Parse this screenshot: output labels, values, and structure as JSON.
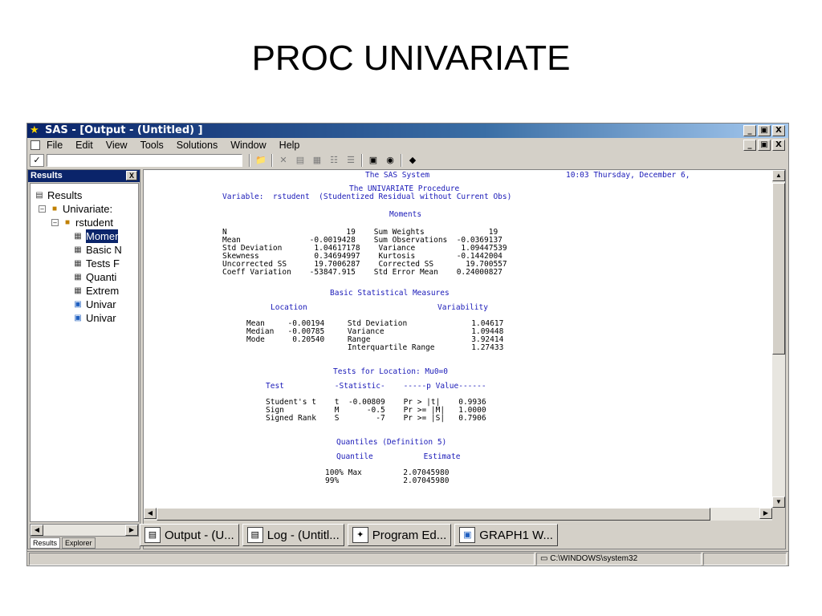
{
  "slide": {
    "title": "PROC UNIVARIATE"
  },
  "window": {
    "title": "SAS - [Output - (Untitled) ]",
    "controls": {
      "minimize": "_",
      "restore": "▣",
      "close": "X"
    }
  },
  "menu": {
    "items": [
      "File",
      "Edit",
      "View",
      "Tools",
      "Solutions",
      "Window",
      "Help"
    ]
  },
  "toolbar": {
    "command_check": "✓",
    "command_value": ""
  },
  "results": {
    "title": "Results",
    "tree": [
      {
        "label": "Results",
        "icon": "results-icon"
      },
      {
        "label": "Univariate:",
        "icon": "folder-icon"
      },
      {
        "label": "rstudent",
        "icon": "folder-icon"
      },
      {
        "label": "Momer",
        "icon": "table-icon"
      },
      {
        "label": "Basic N",
        "icon": "table-icon"
      },
      {
        "label": "Tests F",
        "icon": "table-icon"
      },
      {
        "label": "Quanti",
        "icon": "table-icon"
      },
      {
        "label": "Extrem",
        "icon": "table-icon"
      },
      {
        "label": "Univar",
        "icon": "graph-icon"
      },
      {
        "label": "Univar",
        "icon": "graph-icon"
      }
    ],
    "tabs": [
      "Results",
      "Explorer"
    ]
  },
  "output": {
    "header_title": "The SAS System",
    "header_time": "10:03 Thursday, December 6,",
    "procedure": "The UNIVARIATE Procedure",
    "variable": "Variable:  rstudent  (Studentized Residual without Current Obs)",
    "moments_title": "Moments",
    "moments": [
      "N                          19    Sum Weights              19",
      "Mean               -0.0019428    Sum Observations  -0.0369137",
      "Std Deviation       1.04617178    Variance          1.09447539",
      "Skewness            0.34694997    Kurtosis         -0.1442004",
      "Uncorrected SS      19.7006287    Corrected SS       19.700557",
      "Coeff Variation    -53847.915    Std Error Mean    0.24000827"
    ],
    "basic_title": "Basic Statistical Measures",
    "basic_header_location": "Location",
    "basic_header_variability": "Variability",
    "basic_rows": [
      "Mean     -0.00194     Std Deviation              1.04617",
      "Median   -0.00785     Variance                   1.09448",
      "Mode      0.20540     Range                      3.92414",
      "                      Interquartile Range        1.27433"
    ],
    "tests_title": "Tests for Location: Mu0=0",
    "tests_header": "Test           -Statistic-    -----p Value------",
    "tests_rows": [
      "Student's t    t  -0.00809    Pr > |t|    0.9936",
      "Sign           M      -0.5    Pr >= |M|   1.0000",
      "Signed Rank    S        -7    Pr >= |S|   0.7906"
    ],
    "quantiles_title": "Quantiles (Definition 5)",
    "quantiles_header": "Quantile           Estimate",
    "quantiles_rows": [
      "100% Max         2.07045980",
      "99%              2.07045980"
    ]
  },
  "taskbar": [
    {
      "label": "Output - (U...",
      "icon": "output-window-icon"
    },
    {
      "label": "Log - (Untitl...",
      "icon": "log-window-icon"
    },
    {
      "label": "Program Ed...",
      "icon": "program-editor-icon"
    },
    {
      "label": "GRAPH1  W...",
      "icon": "graph-window-icon"
    }
  ],
  "status": {
    "path": "C:\\WINDOWS\\system32"
  }
}
